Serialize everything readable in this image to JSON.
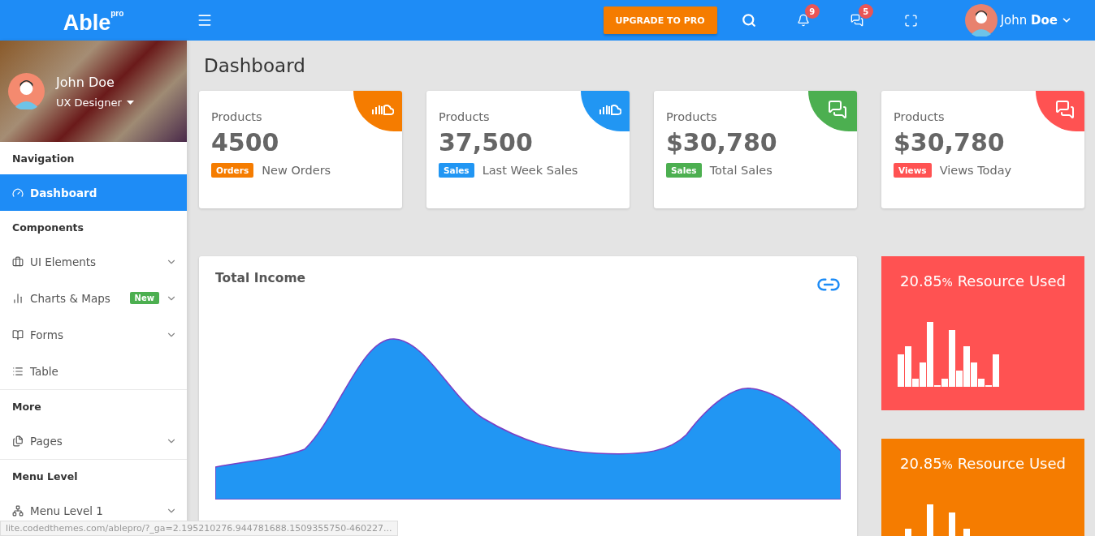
{
  "header": {
    "logo": "Able",
    "logo_sup": "pro",
    "upgrade_button": "UPGRADE TO PRO",
    "notifications_count": "9",
    "messages_count": "5",
    "user_first": "John",
    "user_last": "Doe"
  },
  "sidebar": {
    "profile": {
      "name": "John Doe",
      "role": "UX Designer"
    },
    "sections": [
      {
        "heading": "Navigation",
        "items": [
          {
            "label": "Dashboard",
            "selected": true,
            "submenu": false
          }
        ]
      },
      {
        "heading": "Components",
        "items": [
          {
            "label": "UI Elements",
            "selected": false,
            "submenu": true
          },
          {
            "label": "Charts & Maps",
            "selected": false,
            "submenu": true,
            "badge": "New"
          },
          {
            "label": "Forms",
            "selected": false,
            "submenu": true
          },
          {
            "label": "Table",
            "selected": false,
            "submenu": false
          }
        ]
      },
      {
        "heading": "More",
        "items": [
          {
            "label": "Pages",
            "selected": false,
            "submenu": true
          }
        ]
      },
      {
        "heading": "Menu Level",
        "items": [
          {
            "label": "Menu Level 1",
            "selected": false,
            "submenu": true
          }
        ]
      }
    ]
  },
  "page_title": "Dashboard",
  "stat_cards": [
    {
      "title": "Products",
      "value": "4500",
      "tag": "Orders",
      "caption": "New Orders",
      "color": "#f57c00"
    },
    {
      "title": "Products",
      "value": "37,500",
      "tag": "Sales",
      "caption": "Last Week Sales",
      "color": "#2196f3"
    },
    {
      "title": "Products",
      "value": "$30,780",
      "tag": "Sales",
      "caption": "Total Sales",
      "color": "#4caf50"
    },
    {
      "title": "Products",
      "value": "$30,780",
      "tag": "Views",
      "caption": "Views Today",
      "color": "#ff5252"
    }
  ],
  "income_card": {
    "title": "Total Income"
  },
  "resource_cards": [
    {
      "value": "20.85",
      "unit": "%",
      "label": "Resource Used",
      "color": "#ff5252"
    },
    {
      "value": "20.85",
      "unit": "%",
      "label": "Resource Used",
      "color": "#f57c00"
    }
  ],
  "status_url": "lite.codedthemes.com/ablepro/?_ga=2.195210276.944781688.1509355750-460227..."
}
